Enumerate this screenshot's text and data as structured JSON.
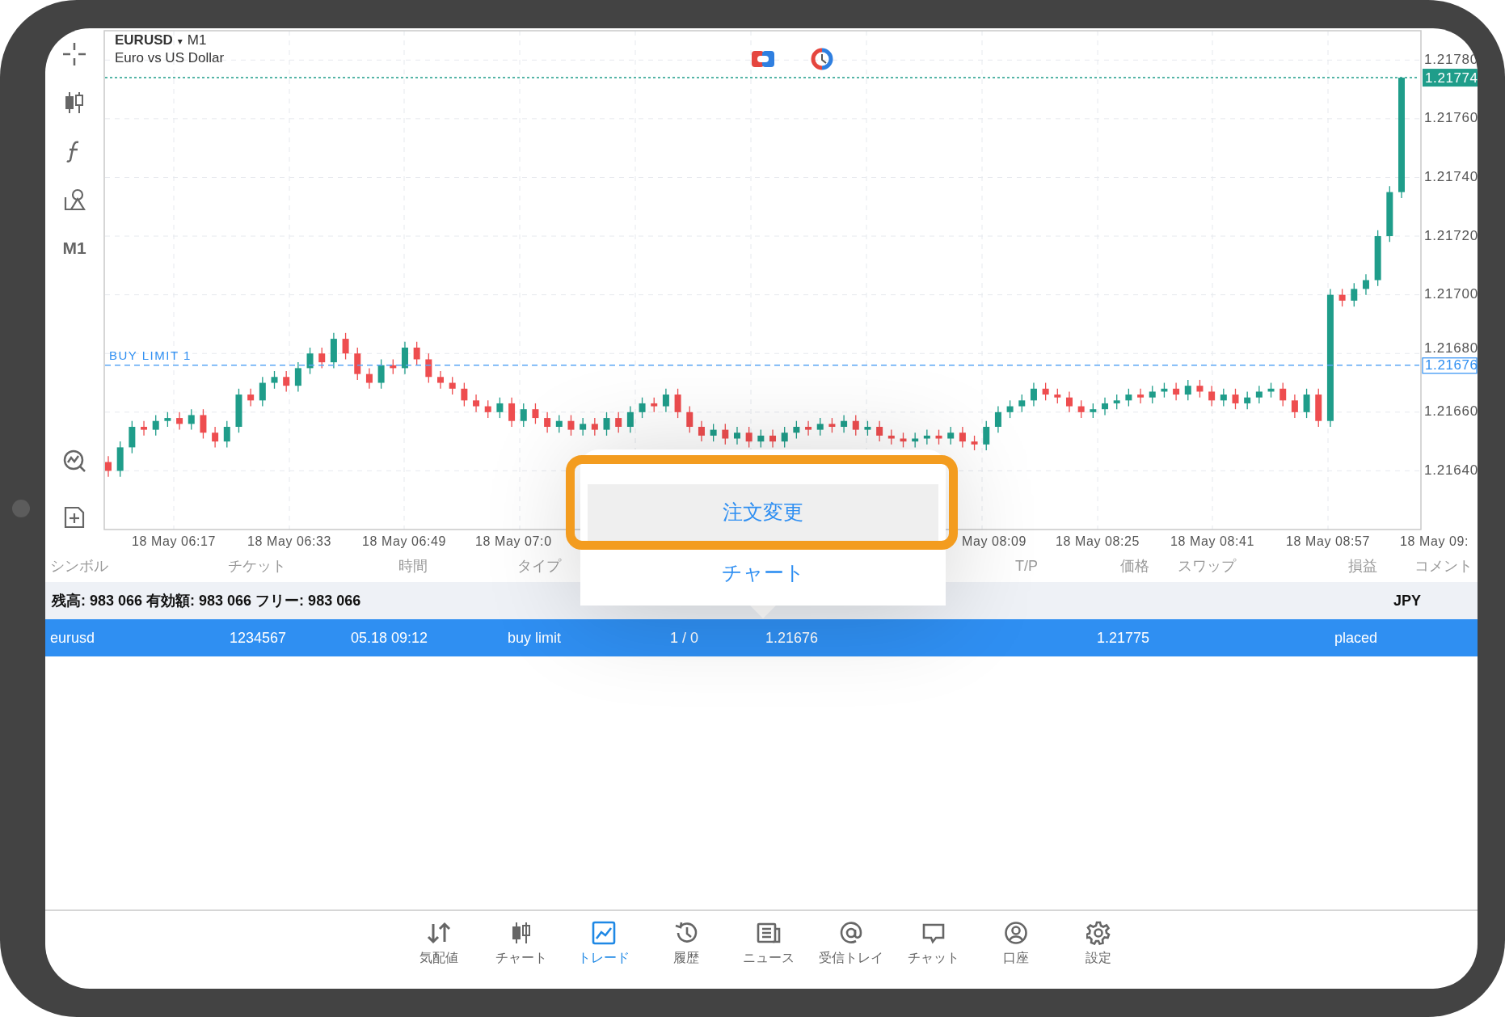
{
  "chart": {
    "symbol": "EURUSD",
    "dropdown": "▾",
    "timeframe": "M1",
    "description": "Euro vs US Dollar",
    "ask_label": "1.21774",
    "order_line": {
      "label": "BUY LIMIT 1",
      "price": "1.21676"
    },
    "time_labels": [
      "18 May 06:17",
      "18 May 06:33",
      "18 May 06:49",
      "18 May 07:0",
      "May 08:09",
      "18 May 08:25",
      "18 May 08:41",
      "18 May 08:57",
      "18 May 09:"
    ],
    "chart_data": {
      "type": "candlestick",
      "categories": [
        null,
        null,
        null,
        null,
        null,
        null,
        null,
        null,
        null,
        null,
        null,
        null,
        null,
        null,
        null,
        null,
        null,
        null,
        null,
        null,
        null,
        null,
        null,
        null,
        null,
        null,
        null,
        null,
        null,
        null,
        null,
        null,
        null,
        null,
        null,
        null,
        null,
        null,
        null,
        null,
        null,
        null,
        null,
        null,
        null,
        null,
        null,
        null,
        null,
        null,
        null,
        null,
        null,
        null,
        null,
        null,
        null,
        null,
        null,
        null,
        null,
        null,
        null,
        null,
        null,
        null,
        null,
        null,
        null,
        null,
        null,
        null,
        null,
        null,
        null,
        null,
        null,
        null,
        null,
        null,
        null,
        null,
        null,
        null,
        null,
        null,
        null,
        null,
        null,
        null,
        null,
        null,
        null,
        null,
        null,
        null,
        null,
        null,
        null,
        null,
        null,
        null,
        null,
        null,
        null,
        null,
        null,
        null,
        null,
        null
      ],
      "ylim": [
        1.2162,
        1.2179
      ],
      "grid": true,
      "yticks": [
        {
          "value": 1.2178,
          "label": "1.21780"
        },
        {
          "value": 1.2176,
          "label": "1.21760"
        },
        {
          "value": 1.2174,
          "label": "1.21740"
        },
        {
          "value": 1.2172,
          "label": "1.21720"
        },
        {
          "value": 1.217,
          "label": "1.21700"
        },
        {
          "value": 1.2168,
          "label": "1.21680"
        },
        {
          "value": 1.2166,
          "label": "1.21660"
        },
        {
          "value": 1.2164,
          "label": "1.21640"
        }
      ],
      "ohlc": [
        [
          1.21643,
          1.21645,
          1.21638,
          1.2164
        ],
        [
          1.2164,
          1.2165,
          1.21638,
          1.21648
        ],
        [
          1.21648,
          1.21657,
          1.21646,
          1.21655
        ],
        [
          1.21655,
          1.21657,
          1.21652,
          1.21654
        ],
        [
          1.21654,
          1.21659,
          1.21652,
          1.21657
        ],
        [
          1.21657,
          1.2166,
          1.21655,
          1.21658
        ],
        [
          1.21658,
          1.2166,
          1.21654,
          1.21656
        ],
        [
          1.21656,
          1.21661,
          1.21654,
          1.21659
        ],
        [
          1.21659,
          1.21661,
          1.21651,
          1.21653
        ],
        [
          1.21653,
          1.21655,
          1.21648,
          1.2165
        ],
        [
          1.2165,
          1.21657,
          1.21648,
          1.21655
        ],
        [
          1.21655,
          1.21668,
          1.21653,
          1.21666
        ],
        [
          1.21666,
          1.21668,
          1.21662,
          1.21664
        ],
        [
          1.21664,
          1.21672,
          1.21662,
          1.2167
        ],
        [
          1.2167,
          1.21674,
          1.21668,
          1.21672
        ],
        [
          1.21672,
          1.21674,
          1.21667,
          1.21669
        ],
        [
          1.21669,
          1.21677,
          1.21667,
          1.21675
        ],
        [
          1.21675,
          1.21682,
          1.21673,
          1.2168
        ],
        [
          1.2168,
          1.21682,
          1.21675,
          1.21677
        ],
        [
          1.21677,
          1.21687,
          1.21675,
          1.21685
        ],
        [
          1.21685,
          1.21687,
          1.21678,
          1.2168
        ],
        [
          1.2168,
          1.21682,
          1.21671,
          1.21673
        ],
        [
          1.21673,
          1.21675,
          1.21668,
          1.2167
        ],
        [
          1.2167,
          1.21678,
          1.21668,
          1.21676
        ],
        [
          1.21676,
          1.21678,
          1.21673,
          1.21675
        ],
        [
          1.21675,
          1.21684,
          1.21673,
          1.21682
        ],
        [
          1.21682,
          1.21684,
          1.21676,
          1.21678
        ],
        [
          1.21678,
          1.2168,
          1.2167,
          1.21672
        ],
        [
          1.21672,
          1.21674,
          1.21668,
          1.2167
        ],
        [
          1.2167,
          1.21672,
          1.21666,
          1.21668
        ],
        [
          1.21668,
          1.2167,
          1.21662,
          1.21664
        ],
        [
          1.21664,
          1.21666,
          1.2166,
          1.21662
        ],
        [
          1.21662,
          1.21664,
          1.21658,
          1.2166
        ],
        [
          1.2166,
          1.21665,
          1.21658,
          1.21663
        ],
        [
          1.21663,
          1.21665,
          1.21655,
          1.21657
        ],
        [
          1.21657,
          1.21663,
          1.21655,
          1.21661
        ],
        [
          1.21661,
          1.21663,
          1.21656,
          1.21658
        ],
        [
          1.21658,
          1.2166,
          1.21653,
          1.21655
        ],
        [
          1.21655,
          1.21659,
          1.21653,
          1.21657
        ],
        [
          1.21657,
          1.21659,
          1.21652,
          1.21654
        ],
        [
          1.21654,
          1.21658,
          1.21652,
          1.21656
        ],
        [
          1.21656,
          1.21658,
          1.21652,
          1.21654
        ],
        [
          1.21654,
          1.2166,
          1.21652,
          1.21658
        ],
        [
          1.21658,
          1.2166,
          1.21653,
          1.21655
        ],
        [
          1.21655,
          1.21662,
          1.21653,
          1.2166
        ],
        [
          1.2166,
          1.21665,
          1.21658,
          1.21663
        ],
        [
          1.21663,
          1.21665,
          1.2166,
          1.21662
        ],
        [
          1.21662,
          1.21668,
          1.2166,
          1.21666
        ],
        [
          1.21666,
          1.21668,
          1.21658,
          1.2166
        ],
        [
          1.2166,
          1.21662,
          1.21653,
          1.21655
        ],
        [
          1.21655,
          1.21657,
          1.2165,
          1.21652
        ],
        [
          1.21652,
          1.21656,
          1.2165,
          1.21654
        ],
        [
          1.21654,
          1.21656,
          1.21649,
          1.21651
        ],
        [
          1.21651,
          1.21655,
          1.21649,
          1.21653
        ],
        [
          1.21653,
          1.21655,
          1.21648,
          1.2165
        ],
        [
          1.2165,
          1.21654,
          1.21648,
          1.21652
        ],
        [
          1.21652,
          1.21654,
          1.21648,
          1.2165
        ],
        [
          1.2165,
          1.21655,
          1.21648,
          1.21653
        ],
        [
          1.21653,
          1.21657,
          1.21651,
          1.21655
        ],
        [
          1.21655,
          1.21657,
          1.21652,
          1.21654
        ],
        [
          1.21654,
          1.21658,
          1.21652,
          1.21656
        ],
        [
          1.21656,
          1.21658,
          1.21653,
          1.21655
        ],
        [
          1.21655,
          1.21659,
          1.21653,
          1.21657
        ],
        [
          1.21657,
          1.21659,
          1.21652,
          1.21654
        ],
        [
          1.21654,
          1.21657,
          1.21652,
          1.21655
        ],
        [
          1.21655,
          1.21657,
          1.2165,
          1.21652
        ],
        [
          1.21652,
          1.21654,
          1.21649,
          1.21651
        ],
        [
          1.21651,
          1.21653,
          1.21648,
          1.2165
        ],
        [
          1.2165,
          1.21653,
          1.21648,
          1.21651
        ],
        [
          1.21651,
          1.21654,
          1.21649,
          1.21652
        ],
        [
          1.21652,
          1.21654,
          1.21649,
          1.21651
        ],
        [
          1.21651,
          1.21655,
          1.21649,
          1.21653
        ],
        [
          1.21653,
          1.21655,
          1.21648,
          1.2165
        ],
        [
          1.2165,
          1.21652,
          1.21647,
          1.21649
        ],
        [
          1.21649,
          1.21657,
          1.21647,
          1.21655
        ],
        [
          1.21655,
          1.21662,
          1.21653,
          1.2166
        ],
        [
          1.2166,
          1.21664,
          1.21658,
          1.21662
        ],
        [
          1.21662,
          1.21666,
          1.2166,
          1.21664
        ],
        [
          1.21664,
          1.2167,
          1.21662,
          1.21668
        ],
        [
          1.21668,
          1.2167,
          1.21664,
          1.21666
        ],
        [
          1.21666,
          1.21668,
          1.21663,
          1.21665
        ],
        [
          1.21665,
          1.21667,
          1.2166,
          1.21662
        ],
        [
          1.21662,
          1.21664,
          1.21658,
          1.2166
        ],
        [
          1.2166,
          1.21663,
          1.21658,
          1.21661
        ],
        [
          1.21661,
          1.21665,
          1.21659,
          1.21663
        ],
        [
          1.21663,
          1.21666,
          1.21661,
          1.21664
        ],
        [
          1.21664,
          1.21668,
          1.21662,
          1.21666
        ],
        [
          1.21666,
          1.21668,
          1.21663,
          1.21665
        ],
        [
          1.21665,
          1.21669,
          1.21663,
          1.21667
        ],
        [
          1.21667,
          1.2167,
          1.21665,
          1.21668
        ],
        [
          1.21668,
          1.2167,
          1.21664,
          1.21666
        ],
        [
          1.21666,
          1.21671,
          1.21664,
          1.21669
        ],
        [
          1.21669,
          1.21671,
          1.21665,
          1.21667
        ],
        [
          1.21667,
          1.21669,
          1.21662,
          1.21664
        ],
        [
          1.21664,
          1.21668,
          1.21662,
          1.21666
        ],
        [
          1.21666,
          1.21668,
          1.21661,
          1.21663
        ],
        [
          1.21663,
          1.21667,
          1.21661,
          1.21665
        ],
        [
          1.21665,
          1.21669,
          1.21663,
          1.21667
        ],
        [
          1.21667,
          1.2167,
          1.21665,
          1.21668
        ],
        [
          1.21668,
          1.2167,
          1.21662,
          1.21664
        ],
        [
          1.21664,
          1.21666,
          1.21658,
          1.2166
        ],
        [
          1.2166,
          1.21668,
          1.21658,
          1.21666
        ],
        [
          1.21666,
          1.21668,
          1.21655,
          1.21657
        ],
        [
          1.21657,
          1.21702,
          1.21655,
          1.217
        ],
        [
          1.217,
          1.21702,
          1.21696,
          1.21698
        ],
        [
          1.21698,
          1.21704,
          1.21696,
          1.21702
        ],
        [
          1.21702,
          1.21707,
          1.217,
          1.21705
        ],
        [
          1.21705,
          1.21722,
          1.21703,
          1.2172
        ],
        [
          1.2172,
          1.21737,
          1.21718,
          1.21735
        ],
        [
          1.21735,
          1.21774,
          1.21733,
          1.21774
        ]
      ]
    }
  },
  "toolbar": {
    "timeframe": "M1"
  },
  "context_menu": {
    "items": [
      {
        "label": "注文変更",
        "highlighted": true
      },
      {
        "label": "チャート",
        "highlighted": false
      }
    ]
  },
  "table": {
    "columns": [
      {
        "label": "シンボル"
      },
      {
        "label": "チケット"
      },
      {
        "label": "時間"
      },
      {
        "label": "タイプ"
      },
      {},
      {},
      {},
      {
        "label": "T/P"
      },
      {
        "label": "価格"
      },
      {
        "label": "スワップ"
      },
      {
        "label": "損益"
      },
      {
        "label": "コメント"
      }
    ],
    "summary": {
      "text": "残高: 983 066 有効額: 983 066 フリー: 983 066",
      "currency": "JPY"
    },
    "rows": [
      {
        "selected": true,
        "cells": [
          "eurusd",
          "1234567",
          "05.18 09:12",
          "buy limit",
          "1 / 0",
          "1.21676",
          null,
          null,
          "1.21775",
          null,
          "placed",
          null
        ]
      }
    ]
  },
  "bottom_nav": [
    {
      "label": "気配値",
      "selected": false
    },
    {
      "label": "チャート",
      "selected": false
    },
    {
      "label": "トレード",
      "selected": true
    },
    {
      "label": "履歴",
      "selected": false
    },
    {
      "label": "ニュース",
      "selected": false
    },
    {
      "label": "受信トレイ",
      "selected": false
    },
    {
      "label": "チャット",
      "selected": false
    },
    {
      "label": "口座",
      "selected": false
    },
    {
      "label": "設定",
      "selected": false
    }
  ]
}
